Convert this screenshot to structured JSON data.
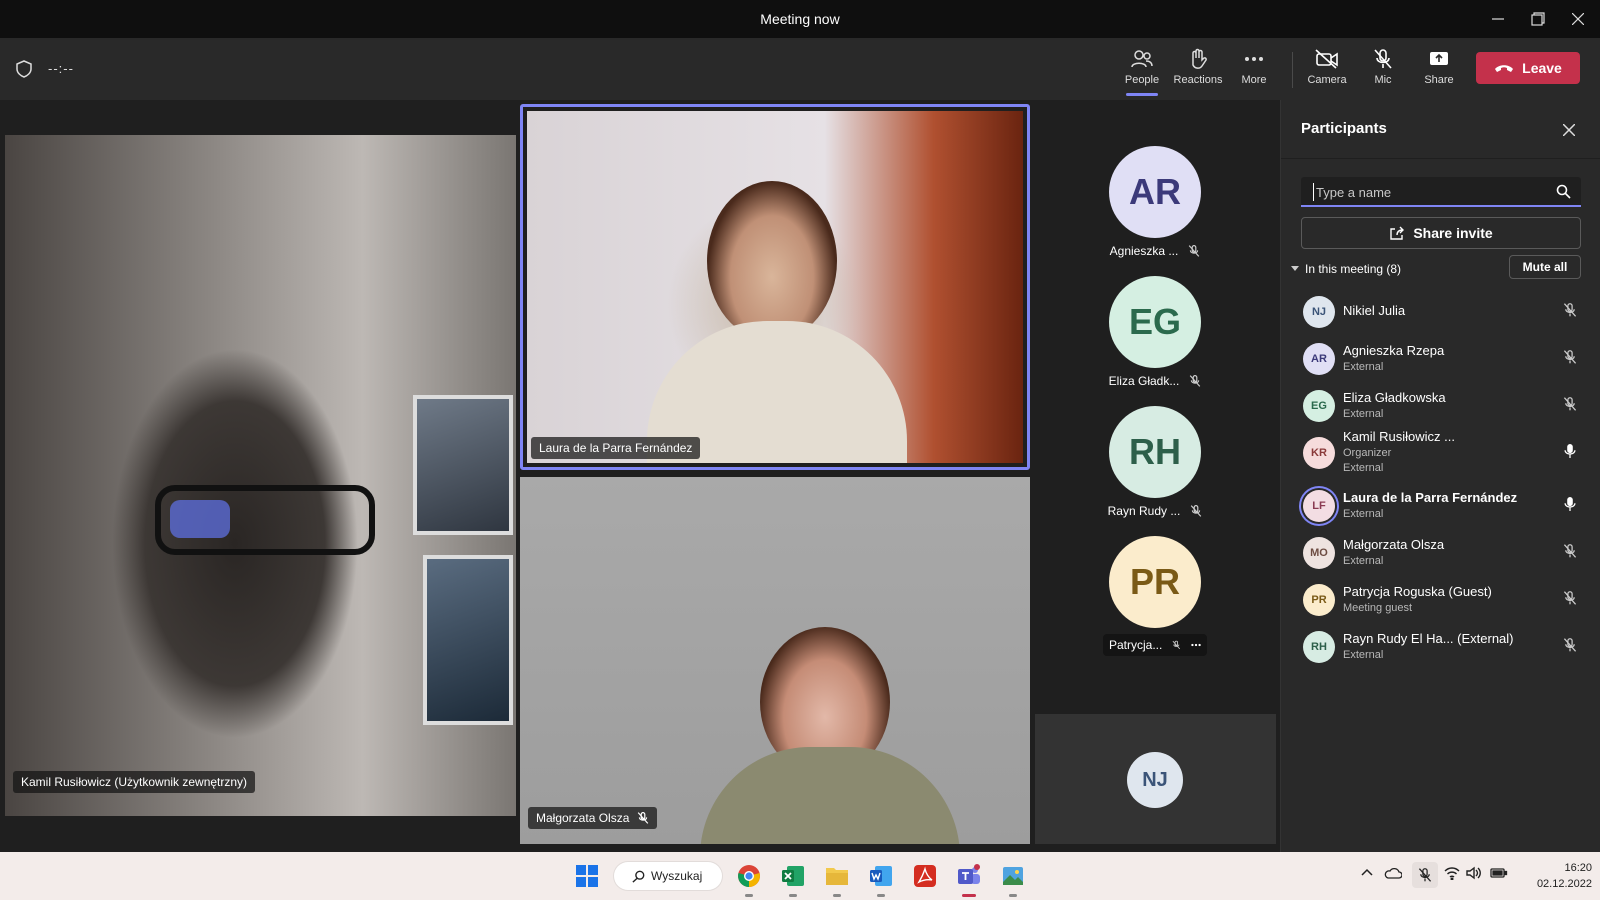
{
  "window": {
    "title": "Meeting now"
  },
  "toolbar": {
    "timer": "--:--",
    "buttons": {
      "people": "People",
      "reactions": "Reactions",
      "more": "More",
      "camera": "Camera",
      "mic": "Mic",
      "share": "Share"
    },
    "leave": "Leave",
    "accent": "#7f85f5",
    "leave_color": "#c4314b"
  },
  "stage": {
    "tiles": {
      "kamil": "Kamil Rusiłowicz (Użytkownik zewnętrzny)",
      "laura": "Laura de la Parra Fernández",
      "malgorzata": "Małgorzata Olsza"
    },
    "avatars": [
      {
        "initials": "AR",
        "name": "Agnieszka ...",
        "bg": "#e0dff5",
        "fg": "#3c3a7a"
      },
      {
        "initials": "EG",
        "name": "Eliza Gładk...",
        "bg": "#d5efe2",
        "fg": "#2b6a4d"
      },
      {
        "initials": "RH",
        "name": "Rayn Rudy ...",
        "bg": "#d7ece3",
        "fg": "#2d5f4a"
      },
      {
        "initials": "PR",
        "name": "Patrycja...",
        "bg": "#fbeccc",
        "fg": "#7a5a16"
      }
    ],
    "nj_tile": {
      "initials": "NJ"
    }
  },
  "participants": {
    "title": "Participants",
    "search_placeholder": "Type a name",
    "share_invite": "Share invite",
    "section": "In this meeting (8)",
    "mute_all": "Mute all",
    "people": [
      {
        "initials": "NJ",
        "name": "Nikiel Julia",
        "sub": [],
        "mic": "muted",
        "bg": "#dfe6ee",
        "fg": "#3b5478"
      },
      {
        "initials": "AR",
        "name": "Agnieszka Rzepa",
        "sub": [
          "External"
        ],
        "mic": "muted",
        "bg": "#e0dff5",
        "fg": "#3c3a7a"
      },
      {
        "initials": "EG",
        "name": "Eliza Gładkowska",
        "sub": [
          "External"
        ],
        "mic": "muted",
        "bg": "#d5efe2",
        "fg": "#2b6a4d"
      },
      {
        "initials": "KR",
        "name": "Kamil Rusiłowicz ...",
        "sub": [
          "Organizer",
          "External"
        ],
        "mic": "on",
        "bg": "#f6dcdc",
        "fg": "#8a3a3a"
      },
      {
        "initials": "LF",
        "name": "Laura de la Parra Fernández",
        "sub": [
          "External"
        ],
        "mic": "on",
        "bg": "#f3dde3",
        "fg": "#8a3a52",
        "speaking": true
      },
      {
        "initials": "MO",
        "name": "Małgorzata Olsza",
        "sub": [
          "External"
        ],
        "mic": "muted",
        "bg": "#eee3e0",
        "fg": "#6d4c42"
      },
      {
        "initials": "PR",
        "name": "Patrycja Roguska (Guest)",
        "sub": [
          "Meeting guest"
        ],
        "mic": "muted",
        "bg": "#fbeccc",
        "fg": "#7a5a16"
      },
      {
        "initials": "RH",
        "name": "Rayn Rudy El Ha... (External)",
        "sub": [
          "External"
        ],
        "mic": "muted",
        "bg": "#d7ece3",
        "fg": "#2d5f4a"
      }
    ]
  },
  "taskbar": {
    "search": "Wyszukaj",
    "time": "16:20",
    "date": "02.12.2022"
  }
}
